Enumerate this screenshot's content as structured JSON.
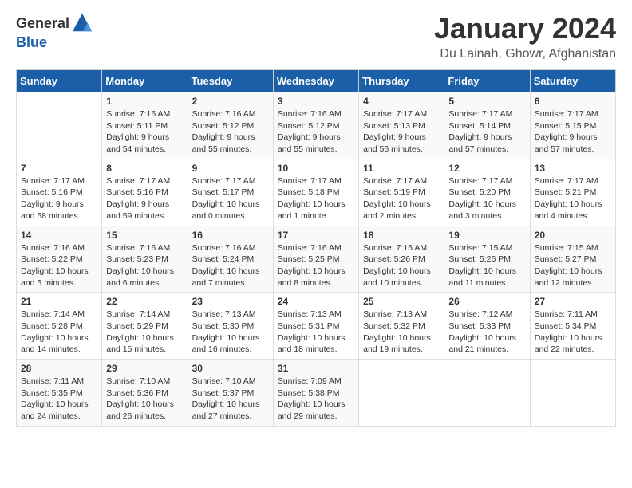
{
  "header": {
    "logo_general": "General",
    "logo_blue": "Blue",
    "title": "January 2024",
    "location": "Du Lainah, Ghowr, Afghanistan"
  },
  "days_of_week": [
    "Sunday",
    "Monday",
    "Tuesday",
    "Wednesday",
    "Thursday",
    "Friday",
    "Saturday"
  ],
  "weeks": [
    [
      {
        "num": "",
        "info": ""
      },
      {
        "num": "1",
        "info": "Sunrise: 7:16 AM\nSunset: 5:11 PM\nDaylight: 9 hours\nand 54 minutes."
      },
      {
        "num": "2",
        "info": "Sunrise: 7:16 AM\nSunset: 5:12 PM\nDaylight: 9 hours\nand 55 minutes."
      },
      {
        "num": "3",
        "info": "Sunrise: 7:16 AM\nSunset: 5:12 PM\nDaylight: 9 hours\nand 55 minutes."
      },
      {
        "num": "4",
        "info": "Sunrise: 7:17 AM\nSunset: 5:13 PM\nDaylight: 9 hours\nand 56 minutes."
      },
      {
        "num": "5",
        "info": "Sunrise: 7:17 AM\nSunset: 5:14 PM\nDaylight: 9 hours\nand 57 minutes."
      },
      {
        "num": "6",
        "info": "Sunrise: 7:17 AM\nSunset: 5:15 PM\nDaylight: 9 hours\nand 57 minutes."
      }
    ],
    [
      {
        "num": "7",
        "info": "Sunrise: 7:17 AM\nSunset: 5:16 PM\nDaylight: 9 hours\nand 58 minutes."
      },
      {
        "num": "8",
        "info": "Sunrise: 7:17 AM\nSunset: 5:16 PM\nDaylight: 9 hours\nand 59 minutes."
      },
      {
        "num": "9",
        "info": "Sunrise: 7:17 AM\nSunset: 5:17 PM\nDaylight: 10 hours\nand 0 minutes."
      },
      {
        "num": "10",
        "info": "Sunrise: 7:17 AM\nSunset: 5:18 PM\nDaylight: 10 hours\nand 1 minute."
      },
      {
        "num": "11",
        "info": "Sunrise: 7:17 AM\nSunset: 5:19 PM\nDaylight: 10 hours\nand 2 minutes."
      },
      {
        "num": "12",
        "info": "Sunrise: 7:17 AM\nSunset: 5:20 PM\nDaylight: 10 hours\nand 3 minutes."
      },
      {
        "num": "13",
        "info": "Sunrise: 7:17 AM\nSunset: 5:21 PM\nDaylight: 10 hours\nand 4 minutes."
      }
    ],
    [
      {
        "num": "14",
        "info": "Sunrise: 7:16 AM\nSunset: 5:22 PM\nDaylight: 10 hours\nand 5 minutes."
      },
      {
        "num": "15",
        "info": "Sunrise: 7:16 AM\nSunset: 5:23 PM\nDaylight: 10 hours\nand 6 minutes."
      },
      {
        "num": "16",
        "info": "Sunrise: 7:16 AM\nSunset: 5:24 PM\nDaylight: 10 hours\nand 7 minutes."
      },
      {
        "num": "17",
        "info": "Sunrise: 7:16 AM\nSunset: 5:25 PM\nDaylight: 10 hours\nand 8 minutes."
      },
      {
        "num": "18",
        "info": "Sunrise: 7:15 AM\nSunset: 5:26 PM\nDaylight: 10 hours\nand 10 minutes."
      },
      {
        "num": "19",
        "info": "Sunrise: 7:15 AM\nSunset: 5:26 PM\nDaylight: 10 hours\nand 11 minutes."
      },
      {
        "num": "20",
        "info": "Sunrise: 7:15 AM\nSunset: 5:27 PM\nDaylight: 10 hours\nand 12 minutes."
      }
    ],
    [
      {
        "num": "21",
        "info": "Sunrise: 7:14 AM\nSunset: 5:28 PM\nDaylight: 10 hours\nand 14 minutes."
      },
      {
        "num": "22",
        "info": "Sunrise: 7:14 AM\nSunset: 5:29 PM\nDaylight: 10 hours\nand 15 minutes."
      },
      {
        "num": "23",
        "info": "Sunrise: 7:13 AM\nSunset: 5:30 PM\nDaylight: 10 hours\nand 16 minutes."
      },
      {
        "num": "24",
        "info": "Sunrise: 7:13 AM\nSunset: 5:31 PM\nDaylight: 10 hours\nand 18 minutes."
      },
      {
        "num": "25",
        "info": "Sunrise: 7:13 AM\nSunset: 5:32 PM\nDaylight: 10 hours\nand 19 minutes."
      },
      {
        "num": "26",
        "info": "Sunrise: 7:12 AM\nSunset: 5:33 PM\nDaylight: 10 hours\nand 21 minutes."
      },
      {
        "num": "27",
        "info": "Sunrise: 7:11 AM\nSunset: 5:34 PM\nDaylight: 10 hours\nand 22 minutes."
      }
    ],
    [
      {
        "num": "28",
        "info": "Sunrise: 7:11 AM\nSunset: 5:35 PM\nDaylight: 10 hours\nand 24 minutes."
      },
      {
        "num": "29",
        "info": "Sunrise: 7:10 AM\nSunset: 5:36 PM\nDaylight: 10 hours\nand 26 minutes."
      },
      {
        "num": "30",
        "info": "Sunrise: 7:10 AM\nSunset: 5:37 PM\nDaylight: 10 hours\nand 27 minutes."
      },
      {
        "num": "31",
        "info": "Sunrise: 7:09 AM\nSunset: 5:38 PM\nDaylight: 10 hours\nand 29 minutes."
      },
      {
        "num": "",
        "info": ""
      },
      {
        "num": "",
        "info": ""
      },
      {
        "num": "",
        "info": ""
      }
    ]
  ]
}
